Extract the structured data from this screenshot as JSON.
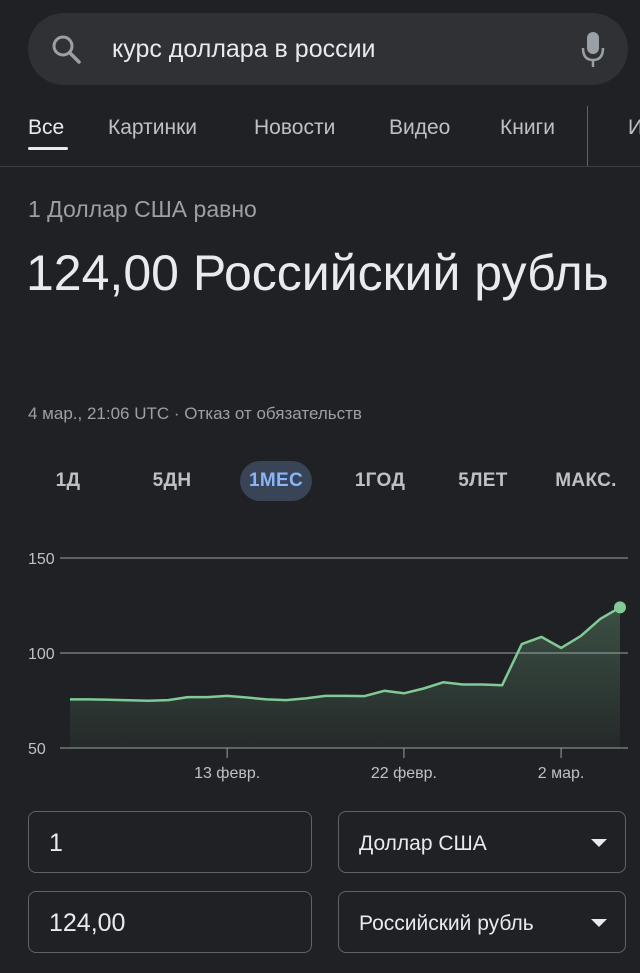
{
  "search": {
    "query": "курс доллара в россии"
  },
  "tabs": [
    {
      "label": "Все"
    },
    {
      "label": "Картинки"
    },
    {
      "label": "Новости"
    },
    {
      "label": "Видео"
    },
    {
      "label": "Книги"
    },
    {
      "label": "И"
    }
  ],
  "result": {
    "equals_label": "1 Доллар США равно",
    "value_text": "124,00 Российский рубль",
    "timestamp": "4 мар., 21:06 UTC",
    "disclaimer": " · Отказ от обязательств"
  },
  "ranges": [
    {
      "label": "1Д"
    },
    {
      "label": "5ДН"
    },
    {
      "label": "1МЕС",
      "active": true
    },
    {
      "label": "1ГОД"
    },
    {
      "label": "5ЛЕТ"
    },
    {
      "label": "МАКС."
    }
  ],
  "chart_data": {
    "type": "area",
    "ylim": [
      50,
      150
    ],
    "y_ticks": [
      150,
      100,
      50
    ],
    "x_ticks": [
      {
        "label": "13 февр.",
        "x": 8
      },
      {
        "label": "22 февр.",
        "x": 17
      },
      {
        "label": "2 мар.",
        "x": 25
      }
    ],
    "x": [
      0,
      1,
      2,
      3,
      4,
      5,
      6,
      7,
      8,
      9,
      10,
      11,
      12,
      13,
      14,
      15,
      16,
      17,
      18,
      19,
      20,
      21,
      22,
      23,
      24,
      25,
      26,
      27,
      28
    ],
    "values": [
      75.6,
      75.6,
      75.4,
      75.1,
      74.9,
      75.2,
      76.8,
      76.8,
      77.4,
      76.6,
      75.6,
      75.2,
      76.1,
      77.4,
      77.4,
      77.3,
      80.1,
      78.8,
      81.3,
      84.6,
      83.4,
      83.4,
      83.0,
      104.7,
      108.5,
      102.7,
      108.9,
      118.0,
      124.0
    ],
    "line_color": "#81c995",
    "fill_color": "#81c995"
  },
  "converter": {
    "from_amount": "1",
    "from_currency": "Доллар США",
    "to_amount": "124,00",
    "to_currency": "Российский рубль"
  }
}
